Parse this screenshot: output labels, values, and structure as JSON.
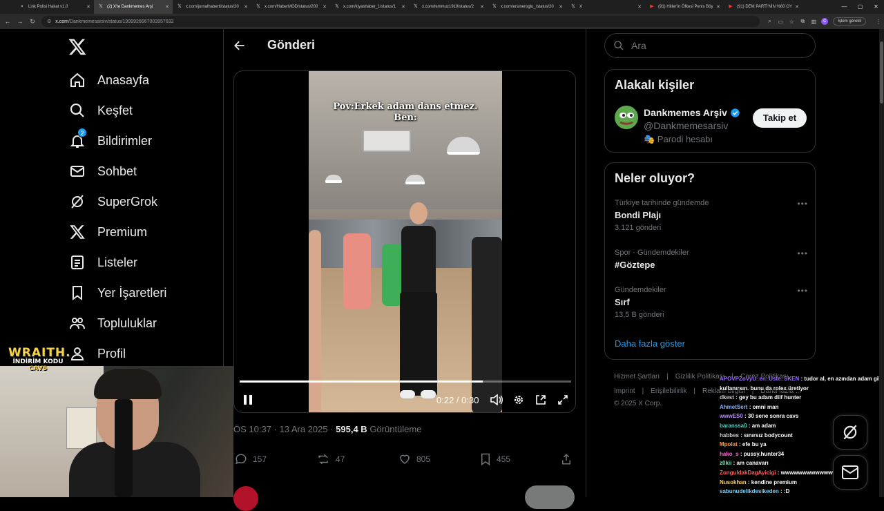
{
  "browser": {
    "tabs": [
      {
        "title": "Link Polisi Hakat v1.0",
        "active": false,
        "icon": "page-icon"
      },
      {
        "title": "(2) X'te Dankmemes Arşi",
        "active": true,
        "icon": "x-icon"
      },
      {
        "title": "x.com/jurnalhaberti/status/20",
        "active": false,
        "icon": "x-icon"
      },
      {
        "title": "x.com/HaberMOD/status/200",
        "active": false,
        "icon": "x-icon"
      },
      {
        "title": "x.com/kiyashaber_1/status/1",
        "active": false,
        "icon": "x-icon"
      },
      {
        "title": "x.com/temmuz1919/status/2",
        "active": false,
        "icon": "x-icon"
      },
      {
        "title": "x.com/ersineroglu_/status/20",
        "active": false,
        "icon": "x-icon"
      },
      {
        "title": "X",
        "active": false,
        "icon": "x-icon"
      },
      {
        "title": "(91) Hitler'in Öfkesi Penis Böy",
        "active": false,
        "icon": "youtube-icon"
      },
      {
        "title": "(91) DEM PARTİ'NİN %60 OY",
        "active": false,
        "icon": "youtube-icon"
      }
    ],
    "url_domain": "x.com",
    "url_path": "/Dankmemesarsiv/status/1999926667003957632",
    "profile_initial": "C",
    "login_label": "İşlem gerekli"
  },
  "sidebar": {
    "items": [
      {
        "label": "Anasayfa",
        "icon": "home-icon"
      },
      {
        "label": "Keşfet",
        "icon": "search-icon"
      },
      {
        "label": "Bildirimler",
        "icon": "bell-icon",
        "badge": "2"
      },
      {
        "label": "Sohbet",
        "icon": "mail-icon"
      },
      {
        "label": "SuperGrok",
        "icon": "grok-icon"
      },
      {
        "label": "Premium",
        "icon": "x-icon"
      },
      {
        "label": "Listeler",
        "icon": "list-icon"
      },
      {
        "label": "Yer İşaretleri",
        "icon": "bookmark-icon"
      },
      {
        "label": "Topluluklar",
        "icon": "communities-icon"
      },
      {
        "label": "Profil",
        "icon": "person-icon"
      }
    ]
  },
  "main": {
    "title": "Gönderi",
    "video": {
      "caption_line1": "Pov:Erkek adam dans etmez.",
      "caption_line2": "Ben:",
      "time": "0:22 / 0:30",
      "progress": 0.733
    },
    "meta": {
      "time": "ÖS 10:37 · 13 Ara 2025 · ",
      "views": "595,4 B",
      "views_label": " Görüntüleme"
    },
    "actions": {
      "replies": "157",
      "reposts": "47",
      "likes": "805",
      "bookmarks": "455"
    }
  },
  "right": {
    "search_placeholder": "Ara",
    "related": {
      "title": "Alakalı kişiler",
      "name": "Dankmemes Arşiv",
      "handle": "@Dankmemesarsiv",
      "parody": "🎭 Parodi hesabı",
      "follow_label": "Takip et"
    },
    "trends": {
      "title": "Neler oluyor?",
      "items": [
        {
          "context": "Türkiye tarihinde gündemde",
          "topic": "Bondi Plajı",
          "count": "3.121 gönderi"
        },
        {
          "context": "Spor · Gündemdekiler",
          "topic": "#Göztepe",
          "count": ""
        },
        {
          "context": "Gündemdekiler",
          "topic": "Sırf",
          "count": "13,5 B gönderi"
        }
      ],
      "show_more": "Daha fazla göster"
    },
    "footer": {
      "line1": [
        "Hizmet Şartları",
        "|",
        "Gizlilik Politikası",
        "|",
        "Çerez Politikası"
      ],
      "line2": [
        "Imprint",
        "|",
        "Erişilebilirlik",
        "|",
        "Reklam bilgisi",
        "|",
        "Daha fazla ..."
      ],
      "copyright": "© 2025 X Corp."
    }
  },
  "overlay": {
    "brand": "WRAITH.",
    "promo": "İNDİRİM KODU",
    "code": "CAVS",
    "chat": [
      {
        "user": "APOVPZoVyU_en_Uste_SKEN",
        "msg": ": tudor al, en azından adam gibi",
        "color": "#9b6bff"
      },
      {
        "user": "",
        "msg": "kullanırsın. bunu da rolex üretiyor",
        "color": "#ffffff"
      },
      {
        "user": "dkest",
        "msg": ": gey bu adam diif hunter",
        "color": "#cfcfcf"
      },
      {
        "user": "AhmetSert",
        "msg": ": omni man",
        "color": "#8ab4ff"
      },
      {
        "user": "wwwES0",
        "msg": ": 30 sene sonra cavs",
        "color": "#b88cff"
      },
      {
        "user": "baranssa0",
        "msg": ": am adam",
        "color": "#4fd1c5"
      },
      {
        "user": "habbes",
        "msg": ": sınırsız bodycount",
        "color": "#cfcfcf"
      },
      {
        "user": "Mpolat",
        "msg": ": efe bu ya",
        "color": "#ff9f43"
      },
      {
        "user": "hako_s",
        "msg": ": pussy.hunter34",
        "color": "#ff6ad5"
      },
      {
        "user": "z0kii",
        "msg": ": am canavarı",
        "color": "#6ee7b7"
      },
      {
        "user": "ZonguldakDagAyicigi",
        "msg": ": wwwwwwwwwwwwwwww",
        "color": "#ff5c5c"
      },
      {
        "user": "Nusokhan",
        "msg": ": kendine premium",
        "color": "#ffd166"
      },
      {
        "user": "sabunudelikdesikeden",
        "msg": ": :D",
        "color": "#7dd3fc"
      }
    ]
  }
}
